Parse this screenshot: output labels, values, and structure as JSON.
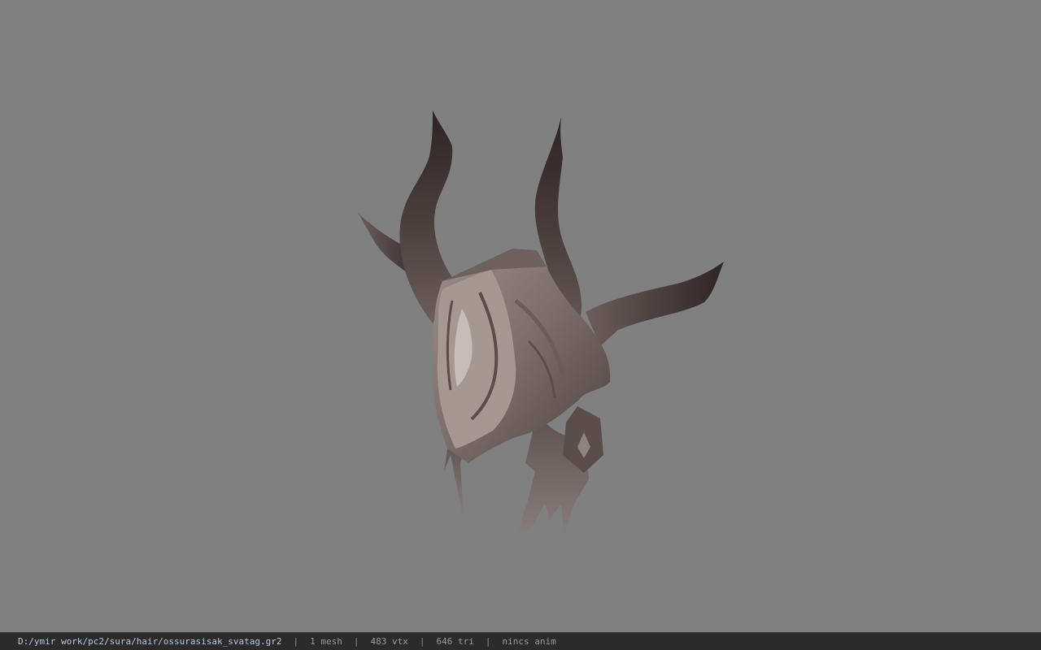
{
  "viewport": {
    "background": "#808080",
    "model_name": "helmet-model"
  },
  "statusbar": {
    "file_path": "D:/ymir work/pc2/sura/hair/ossurasisak_svatag.gr2",
    "separator": "|",
    "mesh_count": "1 mesh",
    "vertex_count": "483 vtx",
    "triangle_count": "646 tri",
    "anim_status": "nincs anim"
  }
}
